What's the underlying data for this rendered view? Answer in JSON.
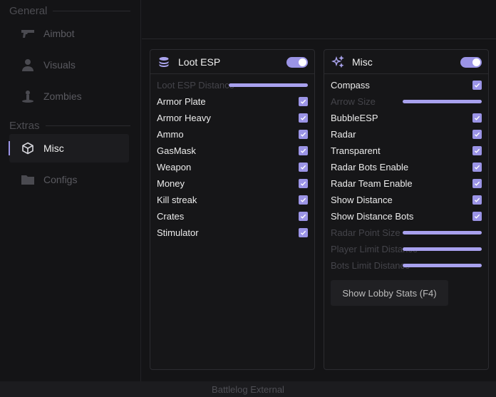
{
  "sidebar": {
    "sections": [
      {
        "title": "General",
        "items": [
          {
            "label": "Aimbot",
            "icon": "gun-icon",
            "active": false
          },
          {
            "label": "Visuals",
            "icon": "person-icon",
            "active": false
          },
          {
            "label": "Zombies",
            "icon": "zombie-icon",
            "active": false
          }
        ]
      },
      {
        "title": "Extras",
        "items": [
          {
            "label": "Misc",
            "icon": "cube-icon",
            "active": true
          },
          {
            "label": "Configs",
            "icon": "folder-icon",
            "active": false
          }
        ]
      }
    ]
  },
  "loot_panel": {
    "title": "Loot ESP",
    "icon": "database-icon",
    "enabled": true,
    "rows": [
      {
        "label": "Loot ESP Distance",
        "type": "slider",
        "value": 100,
        "dim": true
      },
      {
        "label": "Armor Plate",
        "type": "check",
        "checked": true
      },
      {
        "label": "Armor Heavy",
        "type": "check",
        "checked": true
      },
      {
        "label": "Ammo",
        "type": "check",
        "checked": true
      },
      {
        "label": "GasMask",
        "type": "check",
        "checked": true
      },
      {
        "label": "Weapon",
        "type": "check",
        "checked": true
      },
      {
        "label": "Money",
        "type": "check",
        "checked": true
      },
      {
        "label": "Kill streak",
        "type": "check",
        "checked": true
      },
      {
        "label": "Crates",
        "type": "check",
        "checked": true
      },
      {
        "label": "Stimulator",
        "type": "check",
        "checked": true
      }
    ]
  },
  "misc_panel": {
    "title": "Misc",
    "icon": "sparkles-icon",
    "enabled": true,
    "rows": [
      {
        "label": "Compass",
        "type": "check",
        "checked": true
      },
      {
        "label": "Arrow Size",
        "type": "slider",
        "value": 100,
        "dim": true
      },
      {
        "label": "BubbleESP",
        "type": "check",
        "checked": true
      },
      {
        "label": "Radar",
        "type": "check",
        "checked": true
      },
      {
        "label": "Transparent",
        "type": "check",
        "checked": true
      },
      {
        "label": "Radar Bots Enable",
        "type": "check",
        "checked": true
      },
      {
        "label": "Radar Team Enable",
        "type": "check",
        "checked": true
      },
      {
        "label": "Show Distance",
        "type": "check",
        "checked": true
      },
      {
        "label": "Show Distance Bots",
        "type": "check",
        "checked": true
      },
      {
        "label": "Radar Point Size",
        "type": "slider",
        "value": 100,
        "dim": true
      },
      {
        "label": "Player Limit Distance",
        "type": "slider",
        "value": 100,
        "dim": true
      },
      {
        "label": "Bots Limit Distance",
        "type": "slider",
        "value": 100,
        "dim": true
      }
    ],
    "button_label": "Show Lobby Stats (F4)"
  },
  "footer": {
    "title": "Battlelog External"
  },
  "colors": {
    "accent": "#9b94e6",
    "background": "#141416"
  }
}
